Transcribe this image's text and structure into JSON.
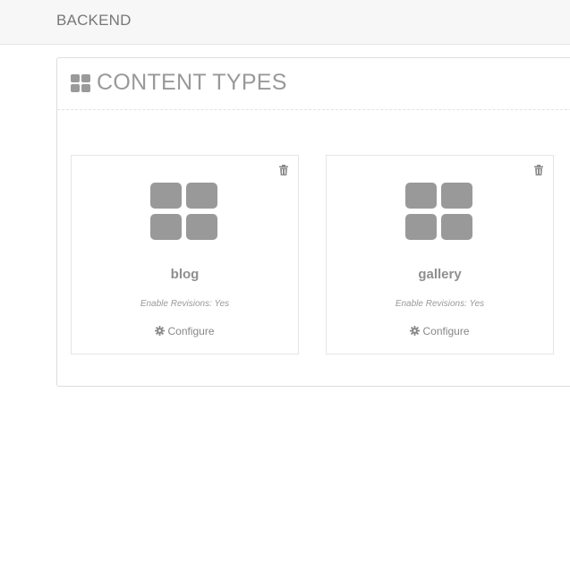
{
  "header": {
    "brand": "BACKEND"
  },
  "panel": {
    "title": "CONTENT TYPES",
    "title_icon": "th-large-icon"
  },
  "content_types": [
    {
      "name": "blog",
      "meta": "Enable Revisions: Yes",
      "configure_label": "Configure",
      "icon": "th-large-icon",
      "delete_icon": "trash-icon"
    },
    {
      "name": "gallery",
      "meta": "Enable Revisions: Yes",
      "configure_label": "Configure",
      "icon": "th-large-icon",
      "delete_icon": "trash-icon"
    }
  ],
  "colors": {
    "icon_gray": "#999999",
    "topbar_bg": "#f7f7f7",
    "border": "#e5e5e5"
  }
}
